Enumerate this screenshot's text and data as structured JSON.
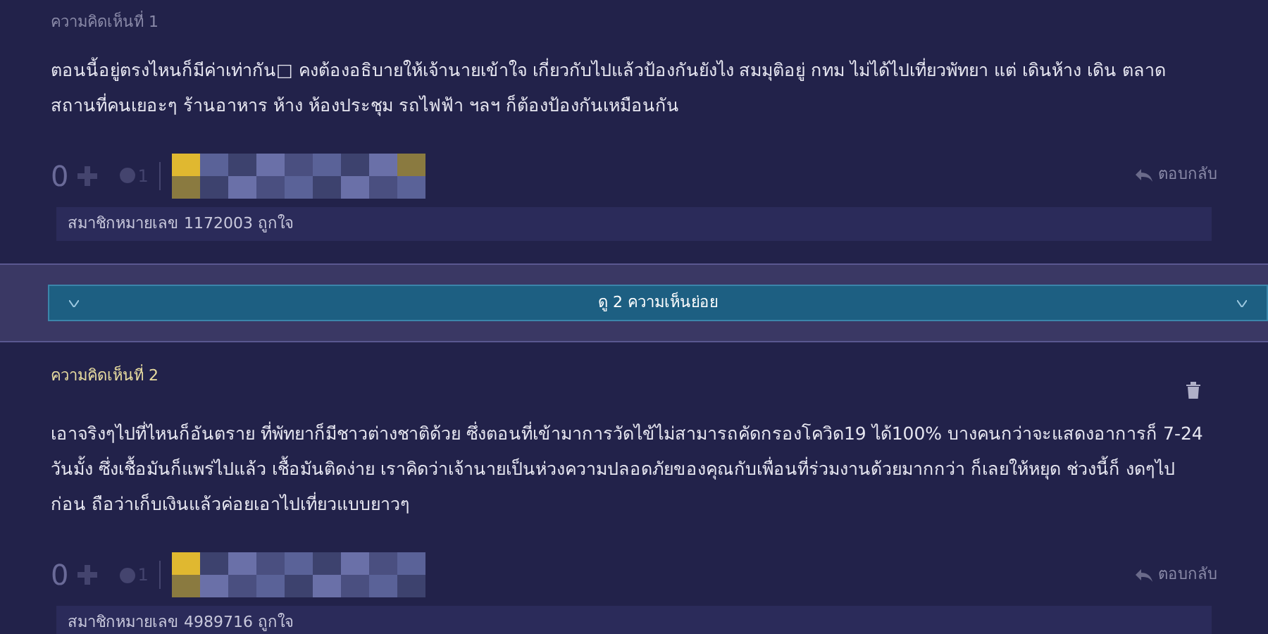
{
  "comments": [
    {
      "label": "ความคิดเห็นที่ 1",
      "highlighted": false,
      "deletable": false,
      "body": "ตอนนี้อยู่ตรงไหนก็มีค่าเท่ากัน□ คงต้องอธิบายให้เจ้านายเข้าใจ เกี่ยวกับไปแล้วป้องกันยังไง สมมุติอยู่ กทม ไม่ได้ไปเที่ยวพัทยา แต่ เดินห้าง เดิน ตลาด สถานที่คนเยอะๆ ร้านอาหาร ห้าง ห้องประชุม รถไฟฟ้า ฯลฯ ก็ต้องป้องกันเหมือนกัน",
      "votes": "0",
      "emotions": "1",
      "reply": "ตอบกลับ",
      "likes": "สมาชิกหมายเลข 1172003 ถูกใจ"
    },
    {
      "label": "ความคิดเห็นที่ 2",
      "highlighted": true,
      "deletable": true,
      "body": "เอาจริงๆไปที่ไหนก็อันตราย ที่พัทยาก็มีชาวต่างชาติด้วย ซึ่งตอนที่เข้ามาการวัดไข้ไม่สามารถคัดกรองโควิด19 ได้100% บางคนกว่าจะแสดงอาการก็ 7-24 วันมั้ง ซึ่งเชื้อมันก็แพร่ไปแล้ว เชื้อมันติดง่าย เราคิดว่าเจ้านายเป็นห่วงความปลอดภัยของคุณกับเพื่อนที่ร่วมงานด้วยมากกว่า ก็เลยให้หยุด ช่วงนี้ก็ งดๆไปก่อน ถือว่าเก็บเงินแล้วค่อยเอาไปเที่ยวแบบยาวๆ",
      "votes": "0",
      "emotions": "1",
      "reply": "ตอบกลับ",
      "likes": "สมาชิกหมายเลข 4989716 ถูกใจ"
    }
  ],
  "sub_replies": {
    "label": "ดู 2 ความเห็นย่อย"
  }
}
